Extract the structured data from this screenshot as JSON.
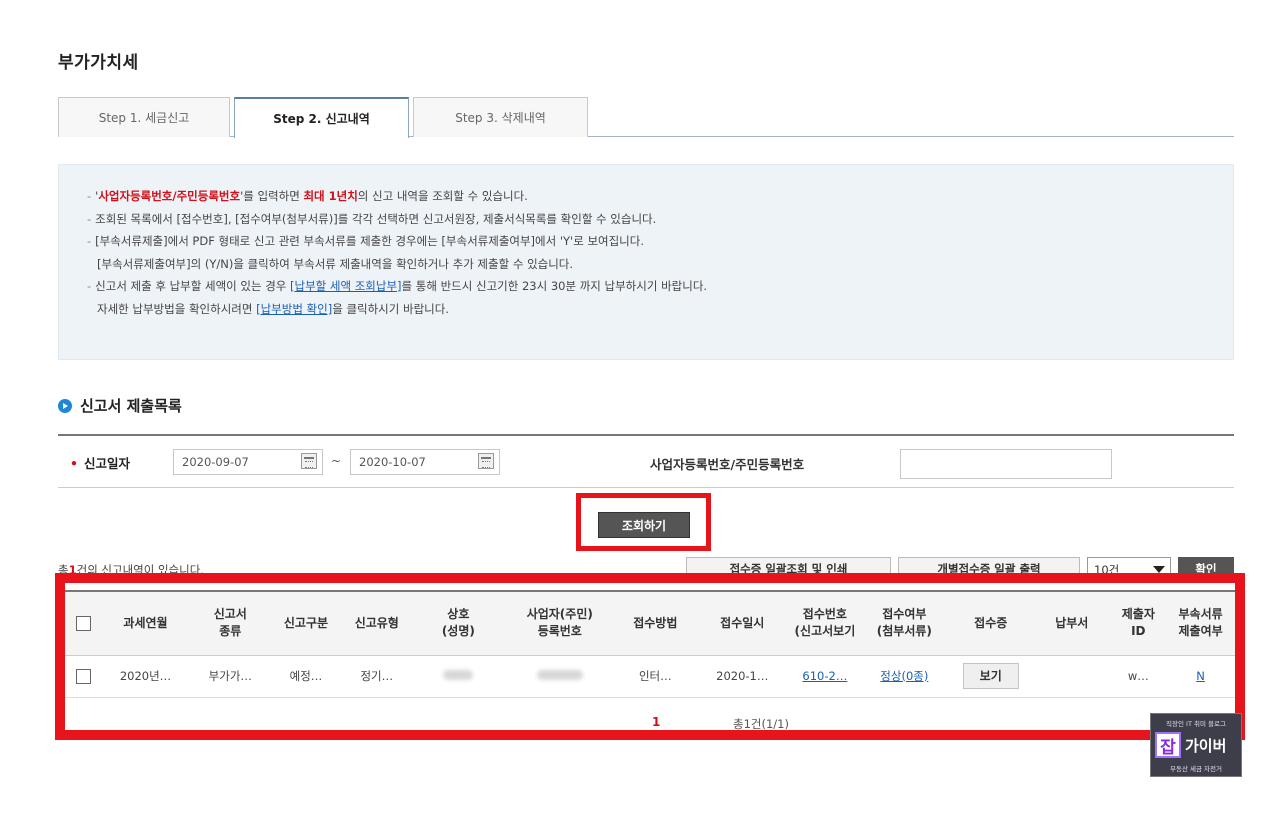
{
  "page_title": "부가가치세",
  "tabs": [
    {
      "label": "Step 1. 세금신고"
    },
    {
      "label": "Step 2. 신고내역"
    },
    {
      "label": "Step 3. 삭제내역"
    }
  ],
  "info": {
    "line1_pre": "'",
    "line1_red": "사업자등록번호/주민등록번호",
    "line1_mid": "'를 입력하면 ",
    "line1_red2": "최대 1년치",
    "line1_post": "의 신고 내역을 조회할 수 있습니다.",
    "line2": "조회된 목록에서 [접수번호], [접수여부(첨부서류)]를 각각 선택하면 신고서원장, 제출서식목록를 확인할 수 있습니다.",
    "line3": "[부속서류제출]에서 PDF 형태로 신고 관련 부속서류를 제출한 경우에는 [부속서류제출여부]에서 'Y'로 보여집니다.",
    "line4": "[부속서류제출여부]의 (Y/N)을 클릭하여 부속서류 제출내역을 확인하거나 추가 제출할 수 있습니다.",
    "line5_pre": "신고서 제출 후 납부할 세액이 있는 경우 ",
    "line5_link": "[납부할 세액 조회납부]",
    "line5_post": "를 통해 반드시 신고기한 23시 30분 까지 납부하시기 바랍니다.",
    "line6_pre": "자세한 납부방법을 확인하시려면 ",
    "line6_link": "[납부방법 확인]",
    "line6_post": "을 클릭하시기 바랍니다."
  },
  "section_title": "신고서 제출목록",
  "search": {
    "date_label": "신고일자",
    "required_mark": "•",
    "date_from": "2020-09-07",
    "date_to": "2020-10-07",
    "tilde": "~",
    "biz_label": "사업자등록번호/주민등록번호",
    "biz_value": ""
  },
  "query_button": "조회하기",
  "result_count": {
    "pre": "총",
    "num": "1",
    "post": "건의 신고내역이 있습니다."
  },
  "toolbar": {
    "batch_view_print": "접수증 일괄조회 및 인쇄",
    "individual_print": "개별접수증 일괄 출력",
    "page_size": "10건",
    "confirm": "확인"
  },
  "table": {
    "headers": [
      {
        "l1": "",
        "l2": ""
      },
      {
        "l1": "과세연월",
        "l2": ""
      },
      {
        "l1": "신고서",
        "l2": "종류"
      },
      {
        "l1": "신고구분",
        "l2": ""
      },
      {
        "l1": "신고유형",
        "l2": ""
      },
      {
        "l1": "상호",
        "l2": "(성명)"
      },
      {
        "l1": "사업자(주민)",
        "l2": "등록번호"
      },
      {
        "l1": "접수방법",
        "l2": ""
      },
      {
        "l1": "접수일시",
        "l2": ""
      },
      {
        "l1": "접수번호",
        "l2": "(신고서보기"
      },
      {
        "l1": "접수여부",
        "l2": "(첨부서류)"
      },
      {
        "l1": "접수증",
        "l2": ""
      },
      {
        "l1": "납부서",
        "l2": ""
      },
      {
        "l1": "제출자",
        "l2": "ID"
      },
      {
        "l1": "부속서류",
        "l2": "제출여부"
      }
    ],
    "row": {
      "period": "2020년…",
      "form": "부가가…",
      "category": "예정…",
      "type": "정기…",
      "method": "인터…",
      "datetime": "2020-1…",
      "receipt_no": "610-2…",
      "status": "정상(0종)",
      "receipt_btn": "보기",
      "payment": "",
      "submitter": "w…",
      "attachment": "N"
    }
  },
  "pager": {
    "current": "1",
    "total": "총1건(1/1)"
  },
  "watermark": {
    "top": "직장인 IT 취미 블로그",
    "brand_mark": "잡",
    "brand": "가이버",
    "bottom": "부동산 세금 자전거"
  },
  "colors": {
    "accent_red": "#e8141c",
    "link_blue": "#1a5fb4",
    "section_icon": "#1e88d6"
  }
}
